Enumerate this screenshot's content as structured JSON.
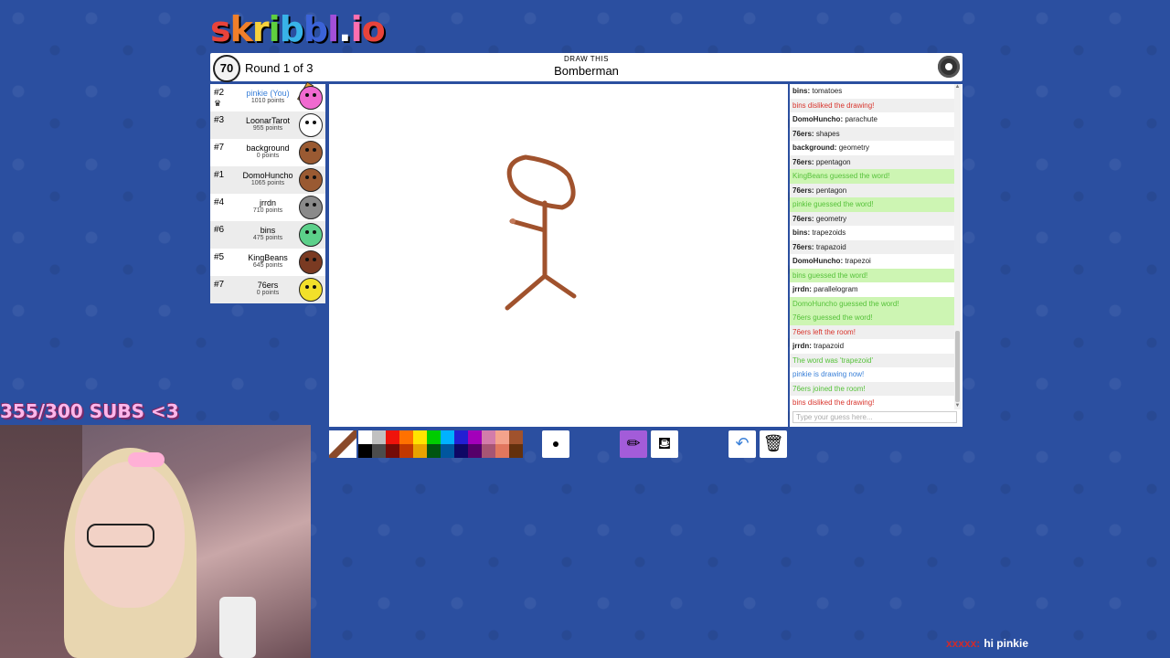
{
  "logo": {
    "text": "skribbl.io",
    "letters": [
      "s",
      "k",
      "r",
      "i",
      "b",
      "b",
      "l",
      ".",
      "i",
      "o"
    ],
    "colors": [
      "#e8433b",
      "#f07f2a",
      "#f6d03c",
      "#5fcf3f",
      "#38b3e8",
      "#3b63d8",
      "#a24fd8",
      "#ffffff",
      "#ff6fb0",
      "#e8433b"
    ]
  },
  "header": {
    "timer": "70",
    "round": "Round 1 of 3",
    "draw_this": "DRAW THIS",
    "word": "Bomberman"
  },
  "players": [
    {
      "rank": "#2",
      "name": "pinkie (You)",
      "points": "1010 points",
      "you": true,
      "owner": true,
      "drawing": true,
      "avatar_color": "#f06ad0"
    },
    {
      "rank": "#3",
      "name": "LoonarTarot",
      "points": "955 points",
      "avatar_color": "#ffffff"
    },
    {
      "rank": "#7",
      "name": "background",
      "points": "0 points",
      "avatar_color": "#9a5a32"
    },
    {
      "rank": "#1",
      "name": "DomoHuncho",
      "points": "1065 points",
      "avatar_color": "#9a5a32"
    },
    {
      "rank": "#4",
      "name": "jrrdn",
      "points": "710 points",
      "avatar_color": "#8a8a8a"
    },
    {
      "rank": "#6",
      "name": "bins",
      "points": "475 points",
      "avatar_color": "#5cd08a"
    },
    {
      "rank": "#5",
      "name": "KingBeans",
      "points": "645 points",
      "avatar_color": "#7a3a22"
    },
    {
      "rank": "#7",
      "name": "76ers",
      "points": "0 points",
      "avatar_color": "#f2e02a"
    }
  ],
  "chat": [
    {
      "user": "bins:",
      "text": "tomatoes",
      "kind": "normal"
    },
    {
      "user": "",
      "text": "bins disliked the drawing!",
      "kind": "red"
    },
    {
      "user": "DomoHuncho:",
      "text": "parachute",
      "kind": "normal"
    },
    {
      "user": "76ers:",
      "text": "shapes",
      "kind": "normal"
    },
    {
      "user": "background:",
      "text": "geometry",
      "kind": "normal"
    },
    {
      "user": "76ers:",
      "text": "ppentagon",
      "kind": "normal"
    },
    {
      "user": "",
      "text": "KingBeans guessed the word!",
      "kind": "green"
    },
    {
      "user": "76ers:",
      "text": "pentagon",
      "kind": "normal"
    },
    {
      "user": "",
      "text": "pinkie guessed the word!",
      "kind": "green"
    },
    {
      "user": "76ers:",
      "text": "geometry",
      "kind": "normal"
    },
    {
      "user": "bins:",
      "text": "trapezoids",
      "kind": "normal"
    },
    {
      "user": "76ers:",
      "text": "trapazoid",
      "kind": "normal"
    },
    {
      "user": "DomoHuncho:",
      "text": "trapezoi",
      "kind": "normal"
    },
    {
      "user": "",
      "text": "bins guessed the word!",
      "kind": "green"
    },
    {
      "user": "jrrdn:",
      "text": "parallelogram",
      "kind": "normal"
    },
    {
      "user": "",
      "text": "DomoHuncho guessed the word!",
      "kind": "green"
    },
    {
      "user": "",
      "text": "76ers guessed the word!",
      "kind": "green"
    },
    {
      "user": "",
      "text": "76ers left the room!",
      "kind": "red"
    },
    {
      "user": "jrrdn:",
      "text": "trapazoid",
      "kind": "normal"
    },
    {
      "user": "",
      "text": "The word was 'trapezoid'",
      "kind": "greentext"
    },
    {
      "user": "",
      "text": "pinkie is drawing now!",
      "kind": "blue"
    },
    {
      "user": "",
      "text": "76ers joined the room!",
      "kind": "greentext"
    },
    {
      "user": "",
      "text": "bins disliked the drawing!",
      "kind": "red"
    }
  ],
  "guess_placeholder": "Type your guess here...",
  "palette": {
    "top": [
      "#ffffff",
      "#c1c1c1",
      "#ef130b",
      "#ff7100",
      "#ffe400",
      "#00cc00",
      "#00b2ff",
      "#231fd3",
      "#a300ba",
      "#d37caa",
      "#f4a38c",
      "#a0522d"
    ],
    "bottom": [
      "#000000",
      "#4c4c4c",
      "#740b07",
      "#c23800",
      "#e8a200",
      "#005510",
      "#00569e",
      "#0e0865",
      "#550069",
      "#a75574",
      "#e1775e",
      "#63300d"
    ]
  },
  "stream": {
    "subs": "355/300 SUBS <3",
    "chat_user": "xxxxx:",
    "chat_text": "hi pinkie"
  }
}
